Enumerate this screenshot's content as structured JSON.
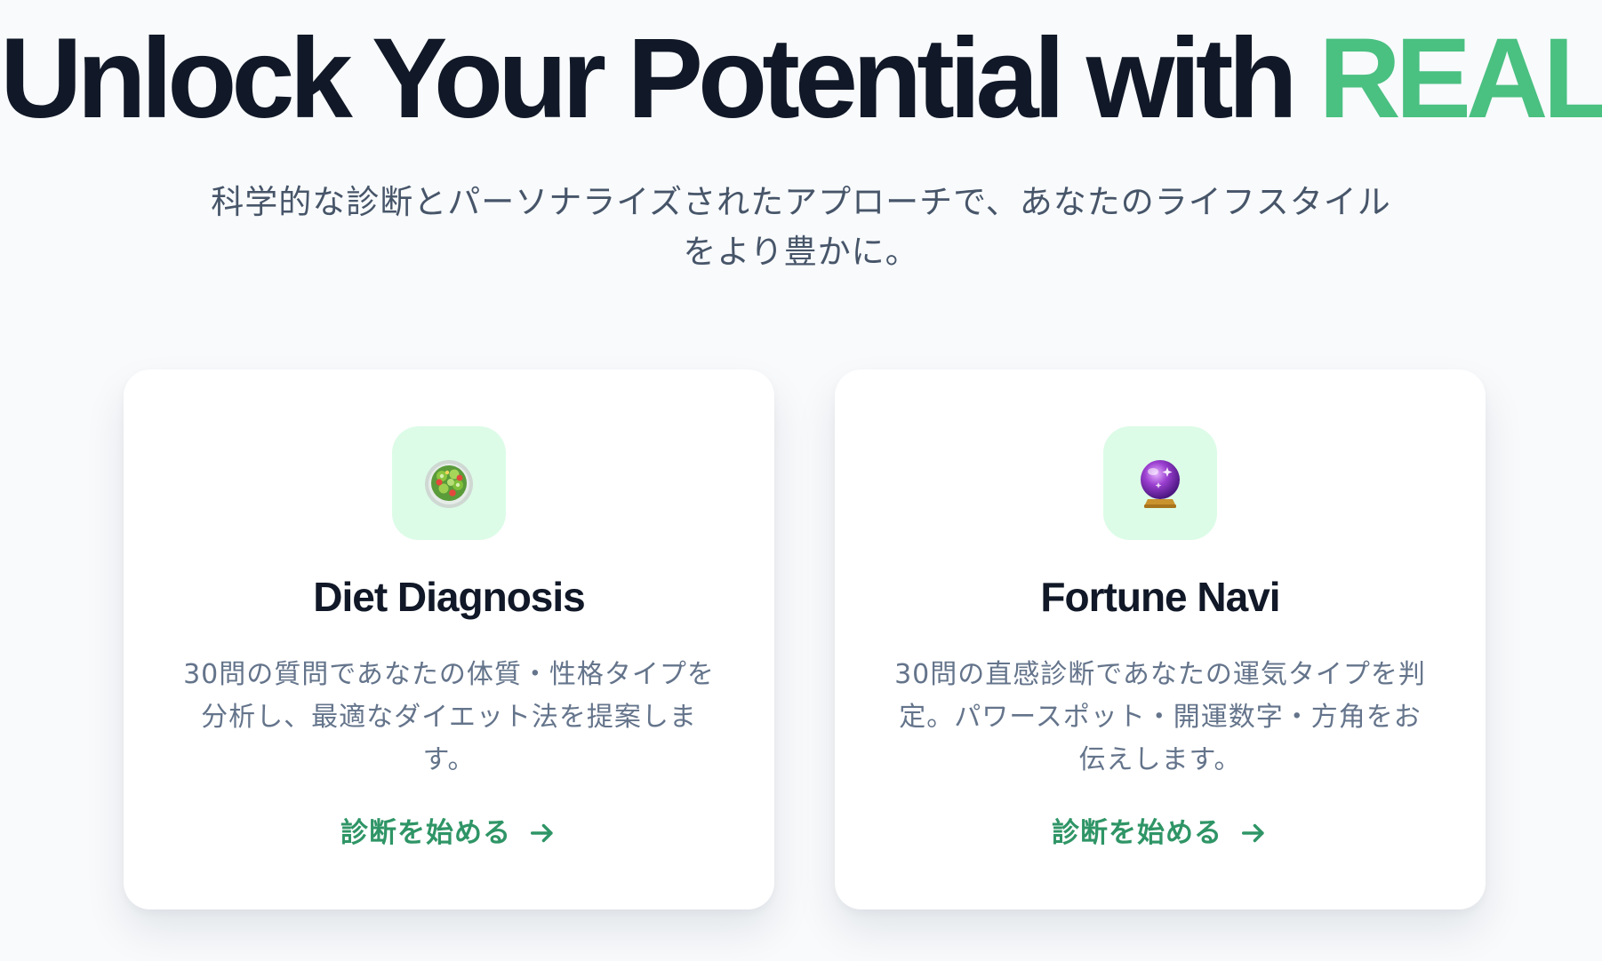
{
  "hero": {
    "title_main": "Unlock Your Potential with ",
    "title_accent": "REAL",
    "subtitle": "科学的な診断とパーソナライズされたアプローチで、あなたのライフスタイルをより豊かに。"
  },
  "colors": {
    "background": "#f8fafc",
    "heading": "#111827",
    "accent": "#4ac081",
    "cta": "#2f9566",
    "icon_bg": "#dcfce7"
  },
  "cards": [
    {
      "icon": "salad-bowl-icon",
      "title": "Diet Diagnosis",
      "description": "30問の質問であなたの体質・性格タイプを分析し、最適なダイエット法を提案します。",
      "cta_label": "診断を始める",
      "cta_icon": "arrow-right-icon"
    },
    {
      "icon": "crystal-ball-icon",
      "title": "Fortune Navi",
      "description": "30問の直感診断であなたの運気タイプを判定。パワースポット・開運数字・方角をお伝えします。",
      "cta_label": "診断を始める",
      "cta_icon": "arrow-right-icon"
    }
  ]
}
